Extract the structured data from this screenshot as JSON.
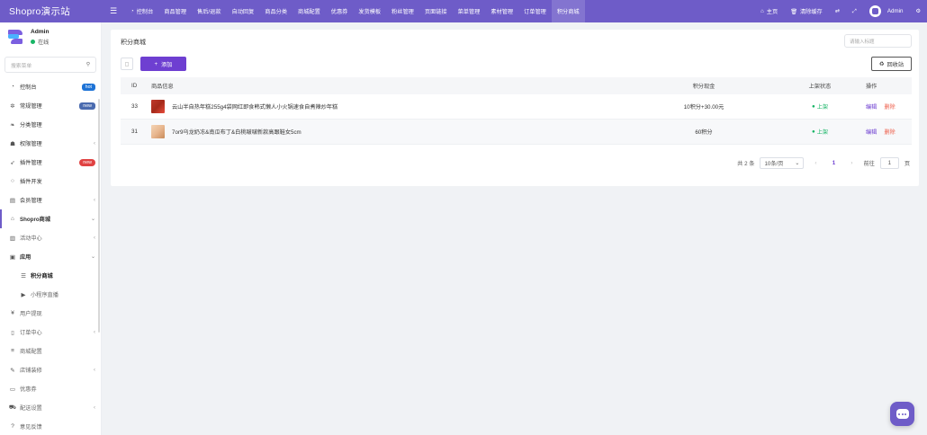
{
  "app": {
    "brand": "Shopro演示站"
  },
  "topnav": [
    {
      "label": "控制台",
      "icon": "dashboard-icon"
    },
    {
      "label": "商品管理",
      "icon": ""
    },
    {
      "label": "售后/退款",
      "icon": ""
    },
    {
      "label": "自动回复",
      "icon": ""
    },
    {
      "label": "商品分类",
      "icon": ""
    },
    {
      "label": "商城配置",
      "icon": ""
    },
    {
      "label": "优惠券",
      "icon": ""
    },
    {
      "label": "发货模板",
      "icon": ""
    },
    {
      "label": "粉丝管理",
      "icon": ""
    },
    {
      "label": "页面链接",
      "icon": ""
    },
    {
      "label": "菜单管理",
      "icon": ""
    },
    {
      "label": "素材管理",
      "icon": ""
    },
    {
      "label": "订单管理",
      "icon": ""
    },
    {
      "label": "积分商城",
      "icon": ""
    }
  ],
  "topright": {
    "home": "主页",
    "clear_cache": "清除缓存",
    "user": "Admin"
  },
  "sidebar": {
    "user": {
      "name": "Admin",
      "status": "在线"
    },
    "search_placeholder": "搜索菜单",
    "items": [
      {
        "label": "控制台",
        "icon": "dashboard-icon",
        "badge": "hot"
      },
      {
        "label": "常规管理",
        "icon": "cogs-icon",
        "badge": "new"
      },
      {
        "label": "分类管理",
        "icon": "leaf-icon"
      },
      {
        "label": "权限管理",
        "icon": "group-icon"
      },
      {
        "label": "插件管理",
        "icon": "rocket-icon",
        "badge": "new"
      },
      {
        "label": "插件开发",
        "icon": "circle-icon"
      },
      {
        "label": "会员管理",
        "icon": "list-icon"
      },
      {
        "label": "Shopro商城",
        "icon": "home-icon"
      },
      {
        "label": "活动中心",
        "icon": "chart-icon"
      },
      {
        "label": "应用",
        "icon": "briefcase-icon"
      },
      {
        "label": "积分商城",
        "icon": "database-icon"
      },
      {
        "label": "小程序直播",
        "icon": "video-icon"
      },
      {
        "label": "用户提现",
        "icon": "yen-icon"
      },
      {
        "label": "订单中心",
        "icon": "file-icon"
      },
      {
        "label": "商城配置",
        "icon": "bars-icon"
      },
      {
        "label": "店铺装修",
        "icon": "brush-icon"
      },
      {
        "label": "优惠券",
        "icon": "ticket-icon"
      },
      {
        "label": "配送设置",
        "icon": "truck-icon"
      },
      {
        "label": "意见反馈",
        "icon": "question-icon"
      }
    ]
  },
  "main": {
    "title": "积分商城",
    "search_placeholder": "请输入标题",
    "add_label": "添加",
    "recycle_label": "回收站",
    "columns": {
      "id": "ID",
      "info": "商品信息",
      "price": "积分现金",
      "status": "上架状态",
      "ops": "操作"
    },
    "rows": [
      {
        "id": "33",
        "title": "云山半自热年糕255g4袋网红即食韩式懒人小火锅速食自煮辣炒年糕",
        "price": "10积分+30.00元",
        "status": "上架",
        "edit": "编辑",
        "del": "删除"
      },
      {
        "id": "31",
        "title": "7or9乌龙奶冻&南瓜布丁&白桃啵啵新款高跟鞋女5cm",
        "price": "60积分",
        "status": "上架",
        "edit": "编辑",
        "del": "删除"
      }
    ],
    "pager": {
      "total": "共 2 条",
      "page_size": "10条/页",
      "current": "1",
      "goto_label": "前往",
      "goto_value": "1",
      "page_suffix": "页"
    }
  }
}
